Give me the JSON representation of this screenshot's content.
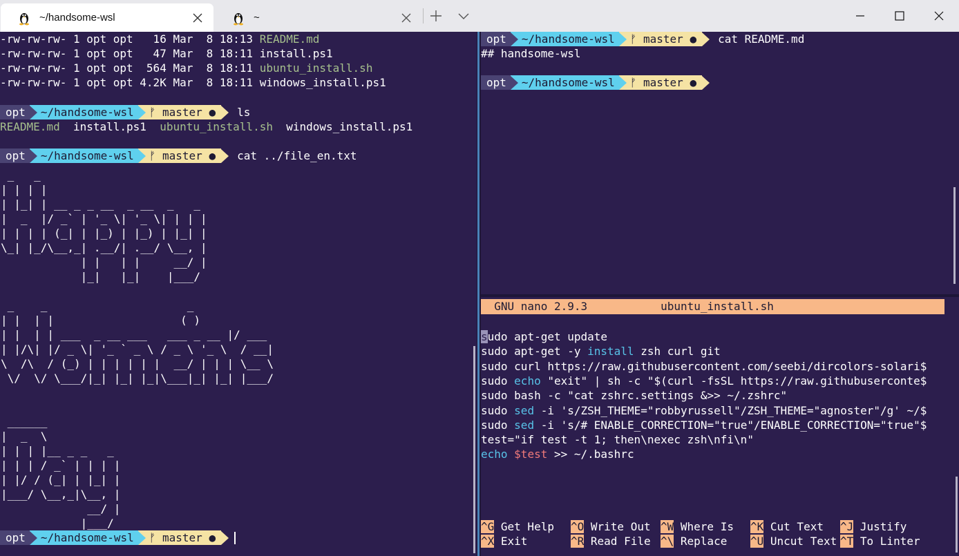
{
  "window": {
    "tabs": [
      {
        "title": "~/handsome-wsl",
        "icon": "linux-penguin-icon"
      },
      {
        "title": "~",
        "icon": "linux-penguin-icon"
      }
    ],
    "controls": [
      "minimize-icon",
      "maximize-icon",
      "close-icon"
    ]
  },
  "prompt": {
    "user": "opt",
    "dir": "~/handsome-wsl",
    "branch_glyph": "ᚠ",
    "branch": "master",
    "dot": "●"
  },
  "left": {
    "ls_lines": [
      {
        "perm": "-rw-rw-rw- 1 opt opt   16 Mar  8 18:13 ",
        "name": "README.md"
      },
      {
        "perm": "-rw-rw-rw- 1 opt opt   47 Mar  8 18:11 ",
        "name": "install.ps1"
      },
      {
        "perm": "-rw-rw-rw- 1 opt opt  564 Mar  8 18:11 ",
        "name": "ubuntu_install.sh"
      },
      {
        "perm": "-rw-rw-rw- 1 opt opt 4.2K Mar  8 18:11 ",
        "name": "windows_install.ps1"
      }
    ],
    "cmd_ls": "ls",
    "ls_output": {
      "f1": "README.md",
      "f2": "install.ps1",
      "f3": "ubuntu_install.sh",
      "f4": "windows_install.ps1"
    },
    "cmd_cat": "cat ../file_en.txt",
    "ascii_art": [
      " _   _                          ",
      "| | | |                         ",
      "| |_| | __ _ _ __  _ __  _   _  ",
      "|  _  |/ _` | '_ \\| '_ \\| | | | ",
      "| | | | (_| | |_) | |_) | |_| | ",
      "\\_| |_/\\__,_| .__/| .__/ \\__, | ",
      "            | |   | |     __/ | ",
      "            |_|   |_|    |___/  ",
      "",
      " _    _                     _  ",
      "| |  | |                   ( ) ",
      "| |  | | ___  _ __ ___   ___ _ __ |/ ___ ",
      "| |/\\| |/ _ \\| '_ ` _ \\ / _ \\ '_ \\  / __|",
      "\\  /\\  / (_) | | | | | |  __/ | | | \\__ \\",
      " \\/  \\/ \\___/|_| |_| |_|\\___|_| |_| |___/",
      "",
      "",
      " ______             ",
      "|  _  \\            ",
      "| | | |__ _ _   _  ",
      "| | | / _` | | | | ",
      "| |/ / (_| | |_| | ",
      "|___/ \\__,_|\\__, | ",
      "             __/ | ",
      "            |___/  "
    ]
  },
  "right_top": {
    "cmd": "cat README.md",
    "output": "## handsome-wsl"
  },
  "nano": {
    "version": "GNU nano 2.9.3",
    "filename": "ubuntu_install.sh",
    "lines": [
      [
        {
          "t": "s",
          "cls": "nano-cursor"
        },
        {
          "t": "udo apt-get update"
        }
      ],
      [
        {
          "t": "sudo apt-get -y "
        },
        {
          "t": "install",
          "cls": "c"
        },
        {
          "t": " zsh curl git"
        }
      ],
      [
        {
          "t": "sudo curl https://raw.githubusercontent.com/seebi/dircolors-solari$"
        }
      ],
      [
        {
          "t": "sudo "
        },
        {
          "t": "echo",
          "cls": "c"
        },
        {
          "t": " \"exit\" | sh -c \"$(curl -fsSL https://raw.githubuserconte$"
        }
      ],
      [
        {
          "t": "sudo bash -c \"cat zshrc.settings &>> ~/.zshrc\""
        }
      ],
      [
        {
          "t": "sudo "
        },
        {
          "t": "sed",
          "cls": "c"
        },
        {
          "t": " -i 's/ZSH_THEME=\"robbyrussell\"/ZSH_THEME=\"agnoster\"/g' ~/$"
        }
      ],
      [
        {
          "t": "sudo "
        },
        {
          "t": "sed",
          "cls": "c"
        },
        {
          "t": " -i 's/# ENABLE_CORRECTION=\"true\"/ENABLE_CORRECTION=\"true\"$"
        }
      ],
      [
        {
          "t": "test=\"if test -t 1; then\\nexec zsh\\nfi\\n\""
        }
      ],
      [
        {
          "t": "echo",
          "cls": "c"
        },
        {
          "t": " "
        },
        {
          "t": "$test",
          "cls": "r"
        },
        {
          "t": " >> ~/.bashrc"
        }
      ]
    ],
    "shortcuts_row1": [
      {
        "key": "^G",
        "label": "Get Help"
      },
      {
        "key": "^O",
        "label": "Write Out"
      },
      {
        "key": "^W",
        "label": "Where Is"
      },
      {
        "key": "^K",
        "label": "Cut Text"
      },
      {
        "key": "^J",
        "label": "Justify"
      }
    ],
    "shortcuts_row2": [
      {
        "key": "^X",
        "label": "Exit"
      },
      {
        "key": "^R",
        "label": "Read File"
      },
      {
        "key": "^\\",
        "label": "Replace"
      },
      {
        "key": "^U",
        "label": "Uncut Text"
      },
      {
        "key": "^T",
        "label": "To Linter"
      }
    ]
  }
}
